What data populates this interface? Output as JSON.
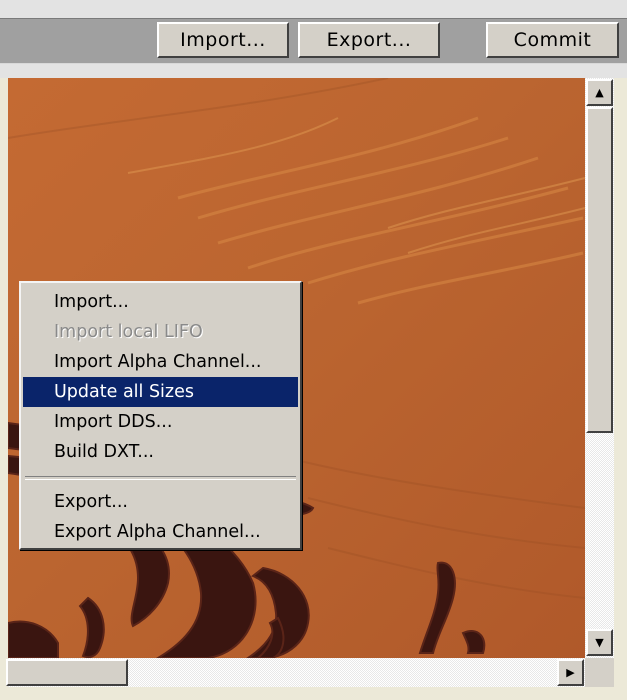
{
  "toolbar": {
    "import_label": "Import...",
    "export_label": "Export...",
    "commit_label": "Commit"
  },
  "scrollbars": {
    "up_arrow": "▲",
    "down_arrow": "▼",
    "right_arrow": "▶"
  },
  "context_menu": {
    "items": [
      {
        "label": "Import...",
        "enabled": true
      },
      {
        "label": "Import local  LIFO",
        "enabled": false
      },
      {
        "label": "Import Alpha Channel...",
        "enabled": true
      },
      {
        "label": "Update all Sizes",
        "enabled": true,
        "highlighted": true
      },
      {
        "label": "Import DDS...",
        "enabled": true
      },
      {
        "label": "Build DXT...",
        "enabled": true
      },
      {
        "label": "Export...",
        "enabled": true
      },
      {
        "label": "Export Alpha Channel...",
        "enabled": true
      }
    ]
  },
  "colors": {
    "texture_base": "#b8642f",
    "ornament": "#3a1510",
    "menu_highlight": "#0a246a"
  }
}
